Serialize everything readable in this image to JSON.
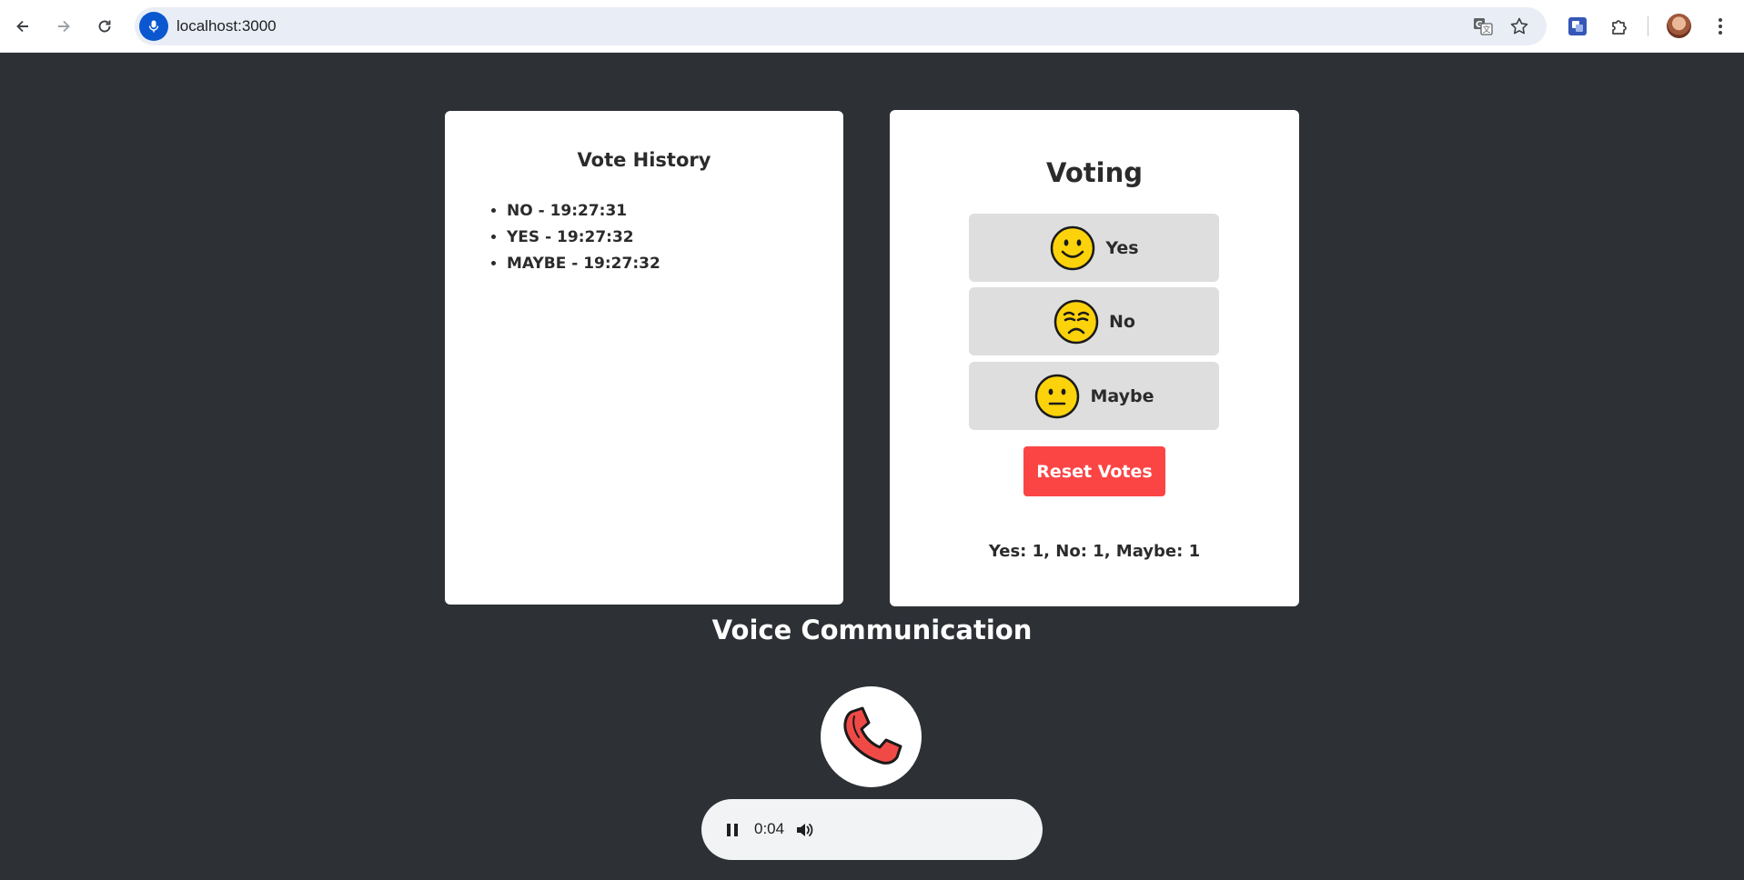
{
  "browser": {
    "url": "localhost:3000",
    "icons": {
      "back": "back-arrow-icon",
      "forward": "forward-arrow-icon",
      "reload": "reload-icon",
      "mic": "microphone-icon",
      "translate": "translate-icon",
      "bookmark": "star-icon",
      "extension1": "extension-app-icon",
      "extensions": "puzzle-icon",
      "profile": "avatar",
      "menu": "kebab-menu-icon"
    }
  },
  "history": {
    "title": "Vote History",
    "entries": [
      "NO - 19:27:31",
      "YES - 19:27:32",
      "MAYBE - 19:27:32"
    ]
  },
  "voting": {
    "title": "Voting",
    "options": [
      {
        "label": "Yes",
        "icon": "smiling-face-icon"
      },
      {
        "label": "No",
        "icon": "frowning-face-icon"
      },
      {
        "label": "Maybe",
        "icon": "neutral-face-icon"
      }
    ],
    "reset_label": "Reset Votes",
    "tally": "Yes: 1, No: 1, Maybe: 1"
  },
  "voice": {
    "title": "Voice Communication",
    "call_icon": "phone-icon",
    "player": {
      "time": "0:04",
      "pause_icon": "pause-icon",
      "volume_icon": "volume-icon"
    }
  },
  "colors": {
    "page_bg": "#2d3035",
    "card_bg": "#ffffff",
    "vote_button_bg": "#dedede",
    "reset_button_bg": "#fb4545",
    "emoji_yellow": "#fcd20a",
    "phone_red": "#f04a47"
  }
}
